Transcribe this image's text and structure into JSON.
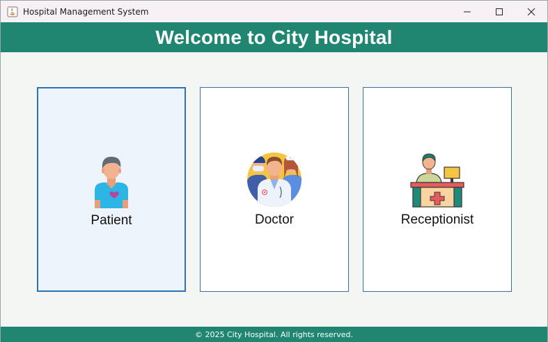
{
  "window": {
    "title": "Hospital Management System",
    "icons": [
      "java-app-icon",
      "minimize-icon",
      "maximize-icon",
      "close-icon"
    ]
  },
  "header": {
    "title": "Welcome to City Hospital",
    "background": "#218671"
  },
  "cards": [
    {
      "label": "Patient",
      "icon": "patient-icon",
      "selected": true
    },
    {
      "label": "Doctor",
      "icon": "doctor-icon",
      "selected": false
    },
    {
      "label": "Receptionist",
      "icon": "receptionist-icon",
      "selected": false
    }
  ],
  "footer": {
    "text": "© 2025 City Hospital. All rights reserved."
  }
}
